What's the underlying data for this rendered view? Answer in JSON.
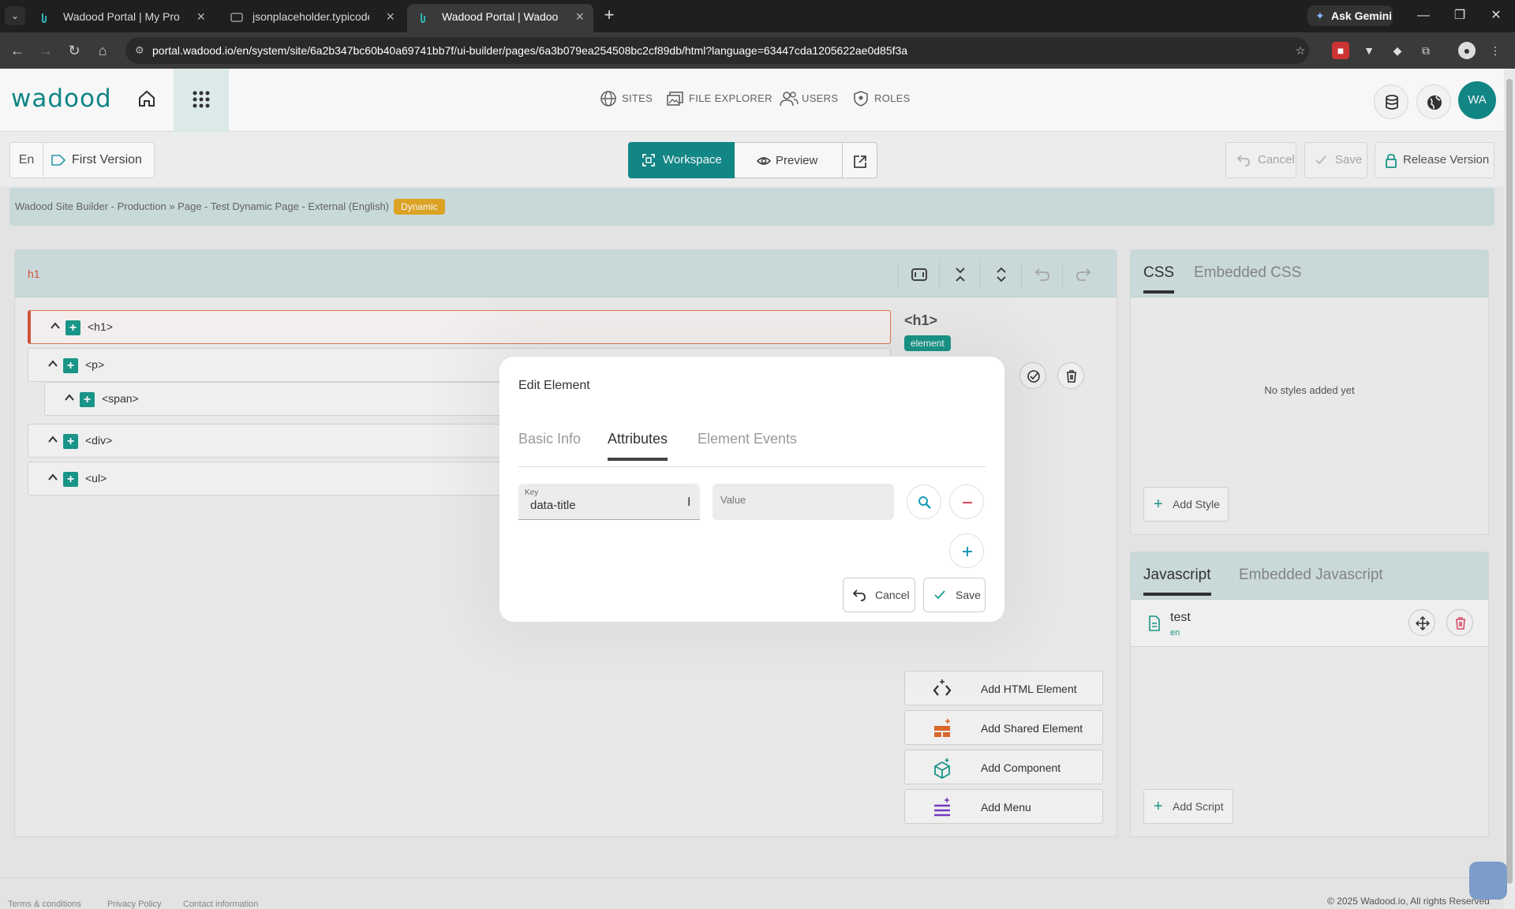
{
  "browser": {
    "tabs": [
      {
        "title": "Wadood Portal | My Profile - U",
        "active": false
      },
      {
        "title": "jsonplaceholder.typicode.com/",
        "active": false
      },
      {
        "title": "Wadood Portal | Wadood Site B",
        "active": true
      }
    ],
    "gemini_label": "Ask Gemini",
    "url": "portal.wadood.io/en/system/site/6a2b347bc60b40a69741bb7f/ui-builder/pages/6a3b079ea254508bc2cf89db/html?language=63447cda1205622ae0d85f3a"
  },
  "header": {
    "logo": "wadood",
    "nav": [
      {
        "label": "SITES",
        "icon": "globe-icon"
      },
      {
        "label": "FILE EXPLORER",
        "icon": "images-icon"
      },
      {
        "label": "USERS",
        "icon": "users-icon"
      },
      {
        "label": "ROLES",
        "icon": "shield-icon"
      }
    ],
    "avatar_initials": "WA"
  },
  "toolbar": {
    "language": "En",
    "version": "First Version",
    "workspace_label": "Workspace",
    "preview_label": "Preview",
    "cancel_label": "Cancel",
    "save_label": "Save",
    "release_label": "Release Version"
  },
  "breadcrumb": {
    "text": "Wadood Site Builder - Production  »  Page - Test Dynamic Page - External (English)",
    "badge": "Dynamic"
  },
  "editor": {
    "selected_label": "h1",
    "tree": [
      {
        "tag": "<h1>",
        "selected": true
      },
      {
        "tag": "<p>",
        "selected": false
      },
      {
        "tag": "<span>",
        "selected": false
      },
      {
        "tag": "<div>",
        "selected": false
      },
      {
        "tag": "<ul>",
        "selected": false
      }
    ],
    "element_heading": "<h1>",
    "element_badge": "element",
    "add_buttons": [
      {
        "label": "Add HTML Element",
        "icon": "code-icon"
      },
      {
        "label": "Add Shared Element",
        "icon": "layout-icon"
      },
      {
        "label": "Add Component",
        "icon": "cube-icon"
      },
      {
        "label": "Add Menu",
        "icon": "menu-icon"
      }
    ]
  },
  "css_panel": {
    "tabs": [
      "CSS",
      "Embedded CSS"
    ],
    "empty_text": "No styles added yet",
    "add_label": "Add Style"
  },
  "js_panel": {
    "tabs": [
      "Javascript",
      "Embedded Javascript"
    ],
    "script_name": "test",
    "script_lang": "en",
    "add_label": "Add Script"
  },
  "footer": {
    "links": [
      "Terms & conditions",
      "Privacy Policy",
      "Contact information"
    ],
    "copyright": "© 2025 Wadood.io, All rights Reserved"
  },
  "modal": {
    "title": "Edit Element",
    "tabs": [
      "Basic Info",
      "Attributes",
      "Element Events"
    ],
    "active_tab": "Attributes",
    "key_label": "Key",
    "key_value": "data-title",
    "value_placeholder": "Value",
    "cancel_label": "Cancel",
    "save_label": "Save"
  },
  "colors": {
    "accent": "#138a8a",
    "danger": "#e0526a",
    "warning": "#e3a825",
    "selection": "#d8553a"
  }
}
